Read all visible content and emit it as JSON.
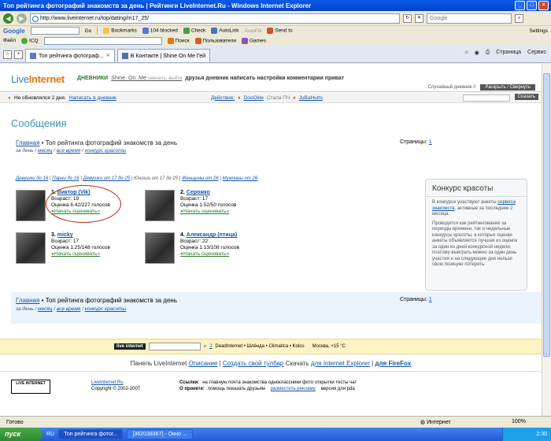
{
  "window": {
    "title": "Топ рейтинга фотографий знакомств за день | Рейтинги LiveInternet.Ru - Windows Internet Explorer"
  },
  "address": {
    "url": "http://www.liveinternet.ru/top/dating/m17_25/",
    "search_placeholder": "Google"
  },
  "google_bar": {
    "logo": "Google",
    "go": "Go",
    "bookmarks": "Bookmarks",
    "blocked": "104 blocked",
    "check": "Check",
    "autolink": "AutoLink",
    "autofill": "AutoFill",
    "send_to": "Send to",
    "settings": "Settings"
  },
  "file_bar": {
    "file": "Файл",
    "icq": "ICQ",
    "search": "Поиск",
    "users": "Пользователи",
    "games": "Games"
  },
  "tabs": [
    {
      "label": "Топ рейтинга фотограф..."
    },
    {
      "label": "В Контакте | Shine On Me Гей"
    }
  ],
  "command_bar": {
    "page": "Страница",
    "service": "Сервис"
  },
  "site": {
    "logo_live": "Live",
    "logo_internet": "Internet",
    "nav_diaries": "ДНЕВНИКИ",
    "nav_user": "Shine_On_Me",
    "nav_change": "сменить, выйти",
    "nav_links": "друзья  дневник  написать  настройки  комментарии  приват",
    "random_diary": "Случайный дневник //",
    "expand": "Раскрыть / Свернуть"
  },
  "strip": {
    "not_updated": "Не обновлялся 2 дня.",
    "write": "Написать в дневник",
    "action": "Действие:",
    "user1": "DooOkle",
    "became": "Стала ПЧ",
    "user2": "JuBaHurts",
    "say": "Сказать"
  },
  "content": {
    "title": "Сообщения",
    "home": "Главная",
    "bullet_title": "Топ рейтинга фотографий знакомств за день",
    "period_day": "за день",
    "period_month": "месяц",
    "period_all": "все время",
    "period_contest": "конкурс красоты",
    "pages_label": "Страницы:",
    "page_num": "1",
    "filters": [
      "Девушки до 16",
      "Парни до 16",
      "Девушки от 17 до 25",
      "Юноши от 17 до 25",
      "Женщины от 26",
      "Мужчины от 26"
    ],
    "people": [
      {
        "num": "1.",
        "name": "Виктор (Vik)",
        "age": "Возраст: 19",
        "score": "Оценка 6.42/227 голосов",
        "rate": "Начать оценивать»"
      },
      {
        "num": "2.",
        "name": "Серожко",
        "age": "Возраст: 17",
        "score": "Оценка 1.52/50 голосов",
        "rate": "Начать оценивать»"
      },
      {
        "num": "3.",
        "name": "micky",
        "age": "Возраст: 17",
        "score": "Оценка 1.25/148 голосов",
        "rate": "Начать оценивать»"
      },
      {
        "num": "4.",
        "name": "Александр (птица)",
        "age": "Возраст: 22",
        "score": "Оценка 1.13/108 голосов",
        "rate": "Начать оценивать»"
      }
    ]
  },
  "contest": {
    "title": "Конкурс красоты",
    "p1_a": "В конкурсе участвуют анкеты ",
    "p1_link": "сервиса знакомств",
    "p1_b": ", активные за последние 2 месяца.",
    "p2": "Проводится как рейтингование за периоды времени, так и недельные конкурсы красоты, в которых оценки анкеты объявляется лучшая из оценок за один из дней конкурсной недели, поэтому выиграть можно за один день участия и на следующие дни нельзя свою позицию потерять."
  },
  "yellow": {
    "badge": "live internet",
    "num": "2",
    "items": "DeadInternet  •  Шлёнда  •  Climatica  •  Kolos",
    "weather": "Москва, +15 °С"
  },
  "panel": {
    "prefix": "Панель LiveInternet",
    "desc": "Описание",
    "create": "Создать свой тулбар",
    "download": "Скачать",
    "ie": "для Internet Explorer",
    "ff": "для FireFox"
  },
  "footer": {
    "logo_text": "LIVE INTERNET",
    "site": "LiveInternet.Ru",
    "copyright": "Copyright © 2002-2007",
    "links_label": "Ссылки:",
    "links": "на главную  почта  знакомства  одноклассники  фото  открытки  тесты  чат",
    "project_label": "О проекте:",
    "project_a": "помощь  показать друзьям",
    "ads": "разместить рекламу",
    "pda": "версия для pda"
  },
  "statusbar": {
    "done": "Готово",
    "zone": "Интернет",
    "zoom": "100%"
  },
  "taskbar": {
    "start": "пуск",
    "lang": "RU",
    "task1": "Топ рейтинга фотог...",
    "task2": "[362038367] - Окно ...",
    "clock": "2:30"
  }
}
